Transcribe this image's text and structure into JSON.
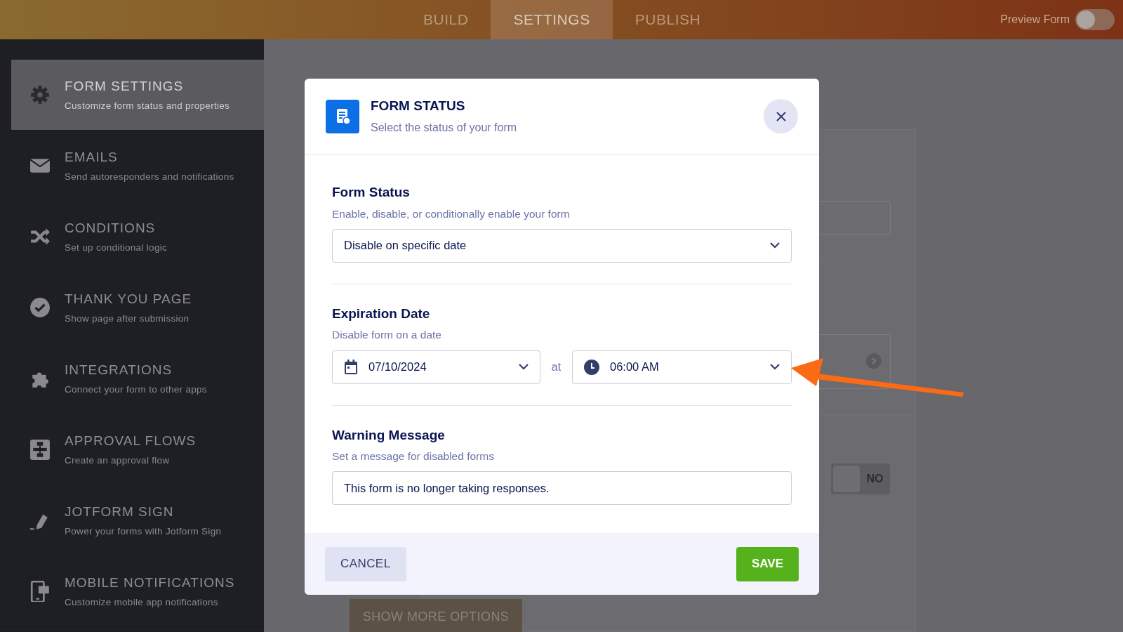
{
  "top_bar": {
    "tabs": [
      {
        "label": "BUILD",
        "selected": false
      },
      {
        "label": "SETTINGS",
        "selected": true
      },
      {
        "label": "PUBLISH",
        "selected": false
      }
    ],
    "preview": {
      "label": "Preview Form",
      "on": false
    }
  },
  "sidebar": {
    "items": [
      {
        "title": "FORM SETTINGS",
        "subtitle": "Customize form status and properties",
        "selected": true
      },
      {
        "title": "EMAILS",
        "subtitle": "Send autoresponders and notifications",
        "selected": false
      },
      {
        "title": "CONDITIONS",
        "subtitle": "Set up conditional logic",
        "selected": false
      },
      {
        "title": "THANK YOU PAGE",
        "subtitle": "Show page after submission",
        "selected": false
      },
      {
        "title": "INTEGRATIONS",
        "subtitle": "Connect your form to other apps",
        "selected": false
      },
      {
        "title": "APPROVAL FLOWS",
        "subtitle": "Create an approval flow",
        "selected": false
      },
      {
        "title": "JOTFORM SIGN",
        "subtitle": "Power your forms with Jotform Sign",
        "selected": false
      },
      {
        "title": "MOBILE NOTIFICATIONS",
        "subtitle": "Customize mobile app notifications",
        "selected": false
      }
    ]
  },
  "background": {
    "toggle": {
      "label": "NO",
      "on": false
    },
    "button": "SHOW MORE OPTIONS"
  },
  "modal": {
    "title": "FORM STATUS",
    "subtitle": "Select the status of your form",
    "sections": [
      {
        "kind": "select",
        "title": "Form Status",
        "description": "Enable, disable, or conditionally enable your form",
        "value": "Disable on specific date"
      },
      {
        "kind": "datetime",
        "title": "Expiration Date",
        "description": "Disable form on a date",
        "date": "07/10/2024",
        "separator": "at",
        "time": "06:00 AM"
      },
      {
        "kind": "text",
        "title": "Warning Message",
        "description": "Set a message for disabled forms",
        "value": "This form is no longer taking responses."
      }
    ],
    "buttons": {
      "cancel": "CANCEL",
      "save": "SAVE"
    }
  }
}
